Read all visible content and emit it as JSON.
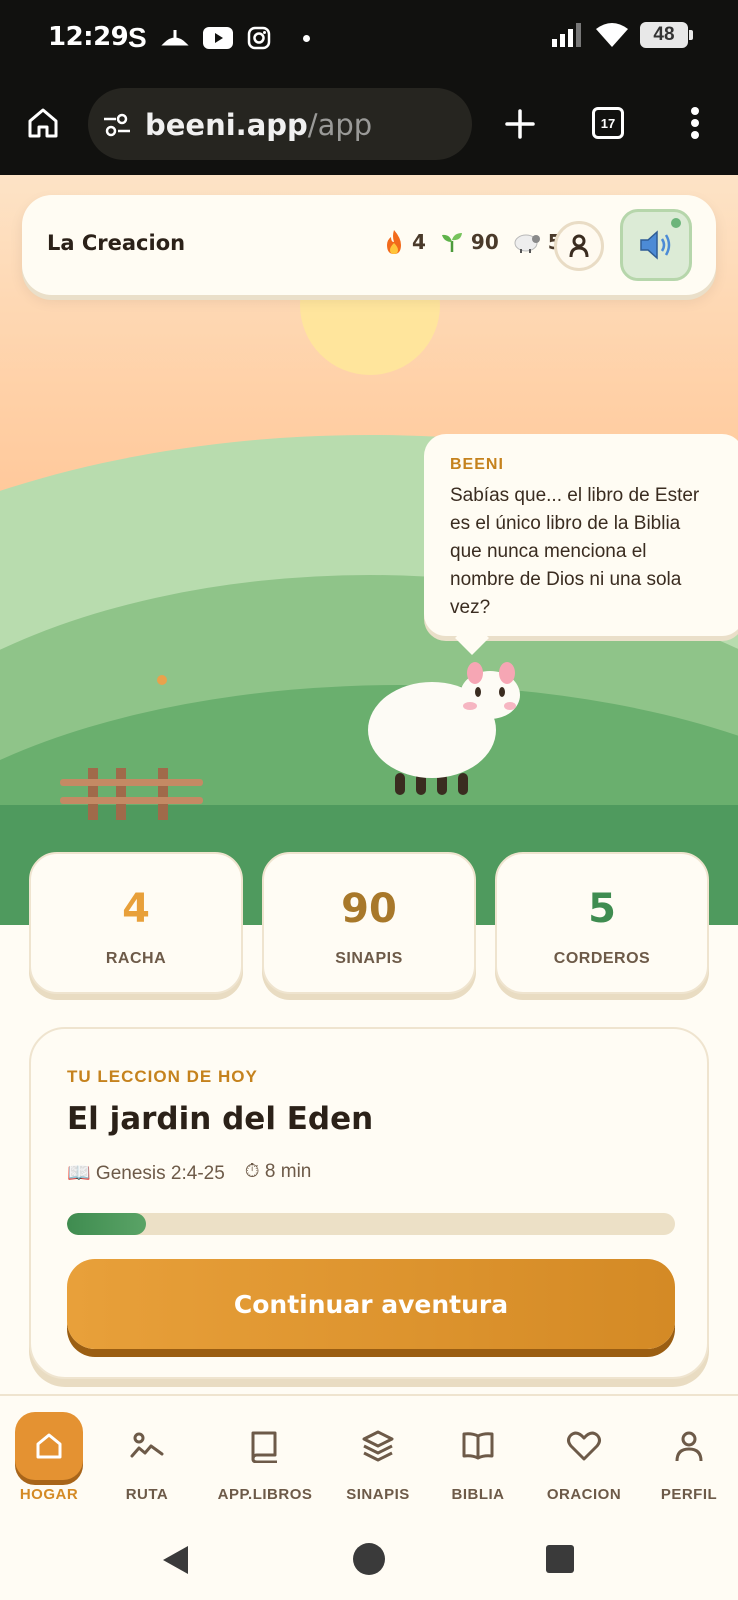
{
  "status_bar": {
    "time": "12:29",
    "battery": "48"
  },
  "browser": {
    "url_host": "beeni.app",
    "url_path": "/app",
    "tab_count": "17"
  },
  "header": {
    "title": "La Creacion",
    "stats": [
      {
        "icon": "flame-icon",
        "value": "4"
      },
      {
        "icon": "sprout-icon",
        "value": "90"
      },
      {
        "icon": "sheep-icon",
        "value": "5"
      }
    ]
  },
  "bubble": {
    "name": "BEENI",
    "text": "Sabías que... el libro de Ester es el único libro de la Biblia que nunca menciona el nombre de Dios ni una sola vez?"
  },
  "stats": [
    {
      "value": "4",
      "label": "RACHA",
      "color": "#e8a03a"
    },
    {
      "value": "90",
      "label": "SINAPIS",
      "color": "#a8782a"
    },
    {
      "value": "5",
      "label": "CORDEROS",
      "color": "#3f8c50"
    }
  ],
  "lesson": {
    "kicker": "TU LECCION DE HOY",
    "title": "El jardin del Eden",
    "reference": "📖 Genesis 2:4-25",
    "duration": "⏱ 8 min",
    "progress": 0.13,
    "cta": "Continuar aventura"
  },
  "nav": [
    {
      "label": "HOGAR",
      "icon": "home-icon",
      "active": true
    },
    {
      "label": "RUTA",
      "icon": "route-icon"
    },
    {
      "label": "APP.LIBROS",
      "icon": "book-icon"
    },
    {
      "label": "SINAPIS",
      "icon": "layers-icon"
    },
    {
      "label": "BIBLIA",
      "icon": "bible-icon"
    },
    {
      "label": "ORACION",
      "icon": "heart-icon"
    },
    {
      "label": "PERFIL",
      "icon": "user-icon"
    }
  ],
  "colors": {
    "accent": "#e49232",
    "green": "#3f8c50",
    "background": "#fffcf4"
  }
}
